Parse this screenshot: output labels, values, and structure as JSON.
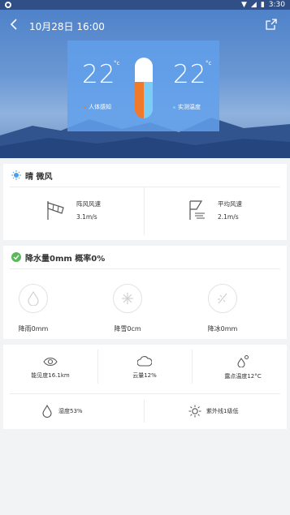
{
  "status_bar": {
    "time": "3:30"
  },
  "header": {
    "title": "10月28日 16:00"
  },
  "temperature": {
    "feel_value": "22",
    "feel_unit": "°c",
    "feel_label": "人体感知",
    "measured_value": "22",
    "measured_unit": "°c",
    "measured_label": "实测温度",
    "colors": {
      "feel_dot": "#f07a2c",
      "measured_dot": "#7ccdf5"
    }
  },
  "weather": {
    "condition": "晴 微风",
    "gust_label": "阵风风速",
    "gust_value": "3.1m/s",
    "avg_label": "平均风速",
    "avg_value": "2.1m/s"
  },
  "precipitation": {
    "heading": "降水量0mm 概率0%",
    "rain": "降雨0mm",
    "snow": "降雪0cm",
    "ice": "降冰0mm"
  },
  "details": {
    "visibility": "能见度16.1km",
    "cloud": "云量12%",
    "dew_point": "露点温度12°C",
    "humidity": "湿度53%",
    "uv": "紫外线1级低"
  },
  "colors": {
    "accent": "#4a9ff0",
    "green": "#5cb85c"
  }
}
